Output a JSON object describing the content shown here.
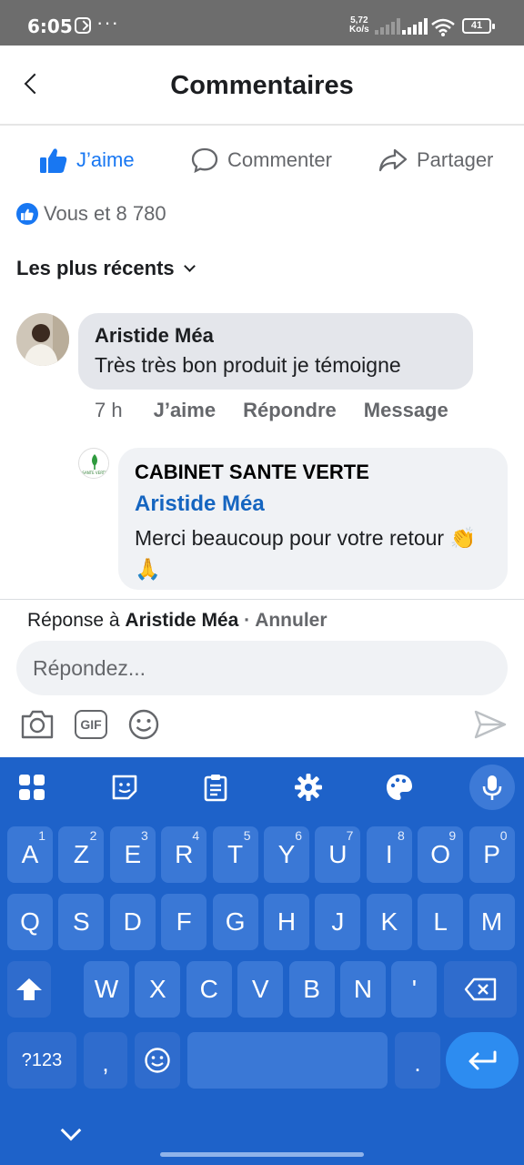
{
  "status_bar": {
    "time": "6:05",
    "dots": "···",
    "net_speed_value": "5,72",
    "net_speed_unit": "Ko/s",
    "battery": "41"
  },
  "header": {
    "title": "Commentaires"
  },
  "actions": {
    "like_label": "J’aime",
    "comment_label": "Commenter",
    "share_label": "Partager"
  },
  "likes_summary": "Vous et 8 780",
  "sort_label": "Les plus récents",
  "comment": {
    "author": "Aristide Méa",
    "text": "Très très bon produit je témoigne",
    "time": "7 h",
    "like": "J’aime",
    "reply": "Répondre",
    "message": "Message"
  },
  "reply": {
    "avatar_text": "SANTE VERTE",
    "author": "CABINET SANTE VERTE",
    "mention": "Aristide Méa",
    "text": "Merci beaucoup pour votre retour 👏🙏"
  },
  "composer": {
    "reply_to_prefix": "Réponse à ",
    "reply_to_name": "Aristide Méa",
    "separator": " · ",
    "cancel": "Annuler",
    "placeholder": "Répondez...",
    "gif_label": "GIF"
  },
  "keyboard": {
    "row1": [
      {
        "k": "A",
        "n": "1"
      },
      {
        "k": "Z",
        "n": "2"
      },
      {
        "k": "E",
        "n": "3"
      },
      {
        "k": "R",
        "n": "4"
      },
      {
        "k": "T",
        "n": "5"
      },
      {
        "k": "Y",
        "n": "6"
      },
      {
        "k": "U",
        "n": "7"
      },
      {
        "k": "I",
        "n": "8"
      },
      {
        "k": "O",
        "n": "9"
      },
      {
        "k": "P",
        "n": "0"
      }
    ],
    "row2": [
      "Q",
      "S",
      "D",
      "F",
      "G",
      "H",
      "J",
      "K",
      "L",
      "M"
    ],
    "row3": [
      "W",
      "X",
      "C",
      "V",
      "B",
      "N",
      "'"
    ],
    "numbers_key": "?123",
    "comma_key": ",",
    "period_key": "."
  },
  "colors": {
    "accent": "#1877f2",
    "keyboard_bg": "#1e62c9",
    "key_bg": "#3a78d6"
  }
}
